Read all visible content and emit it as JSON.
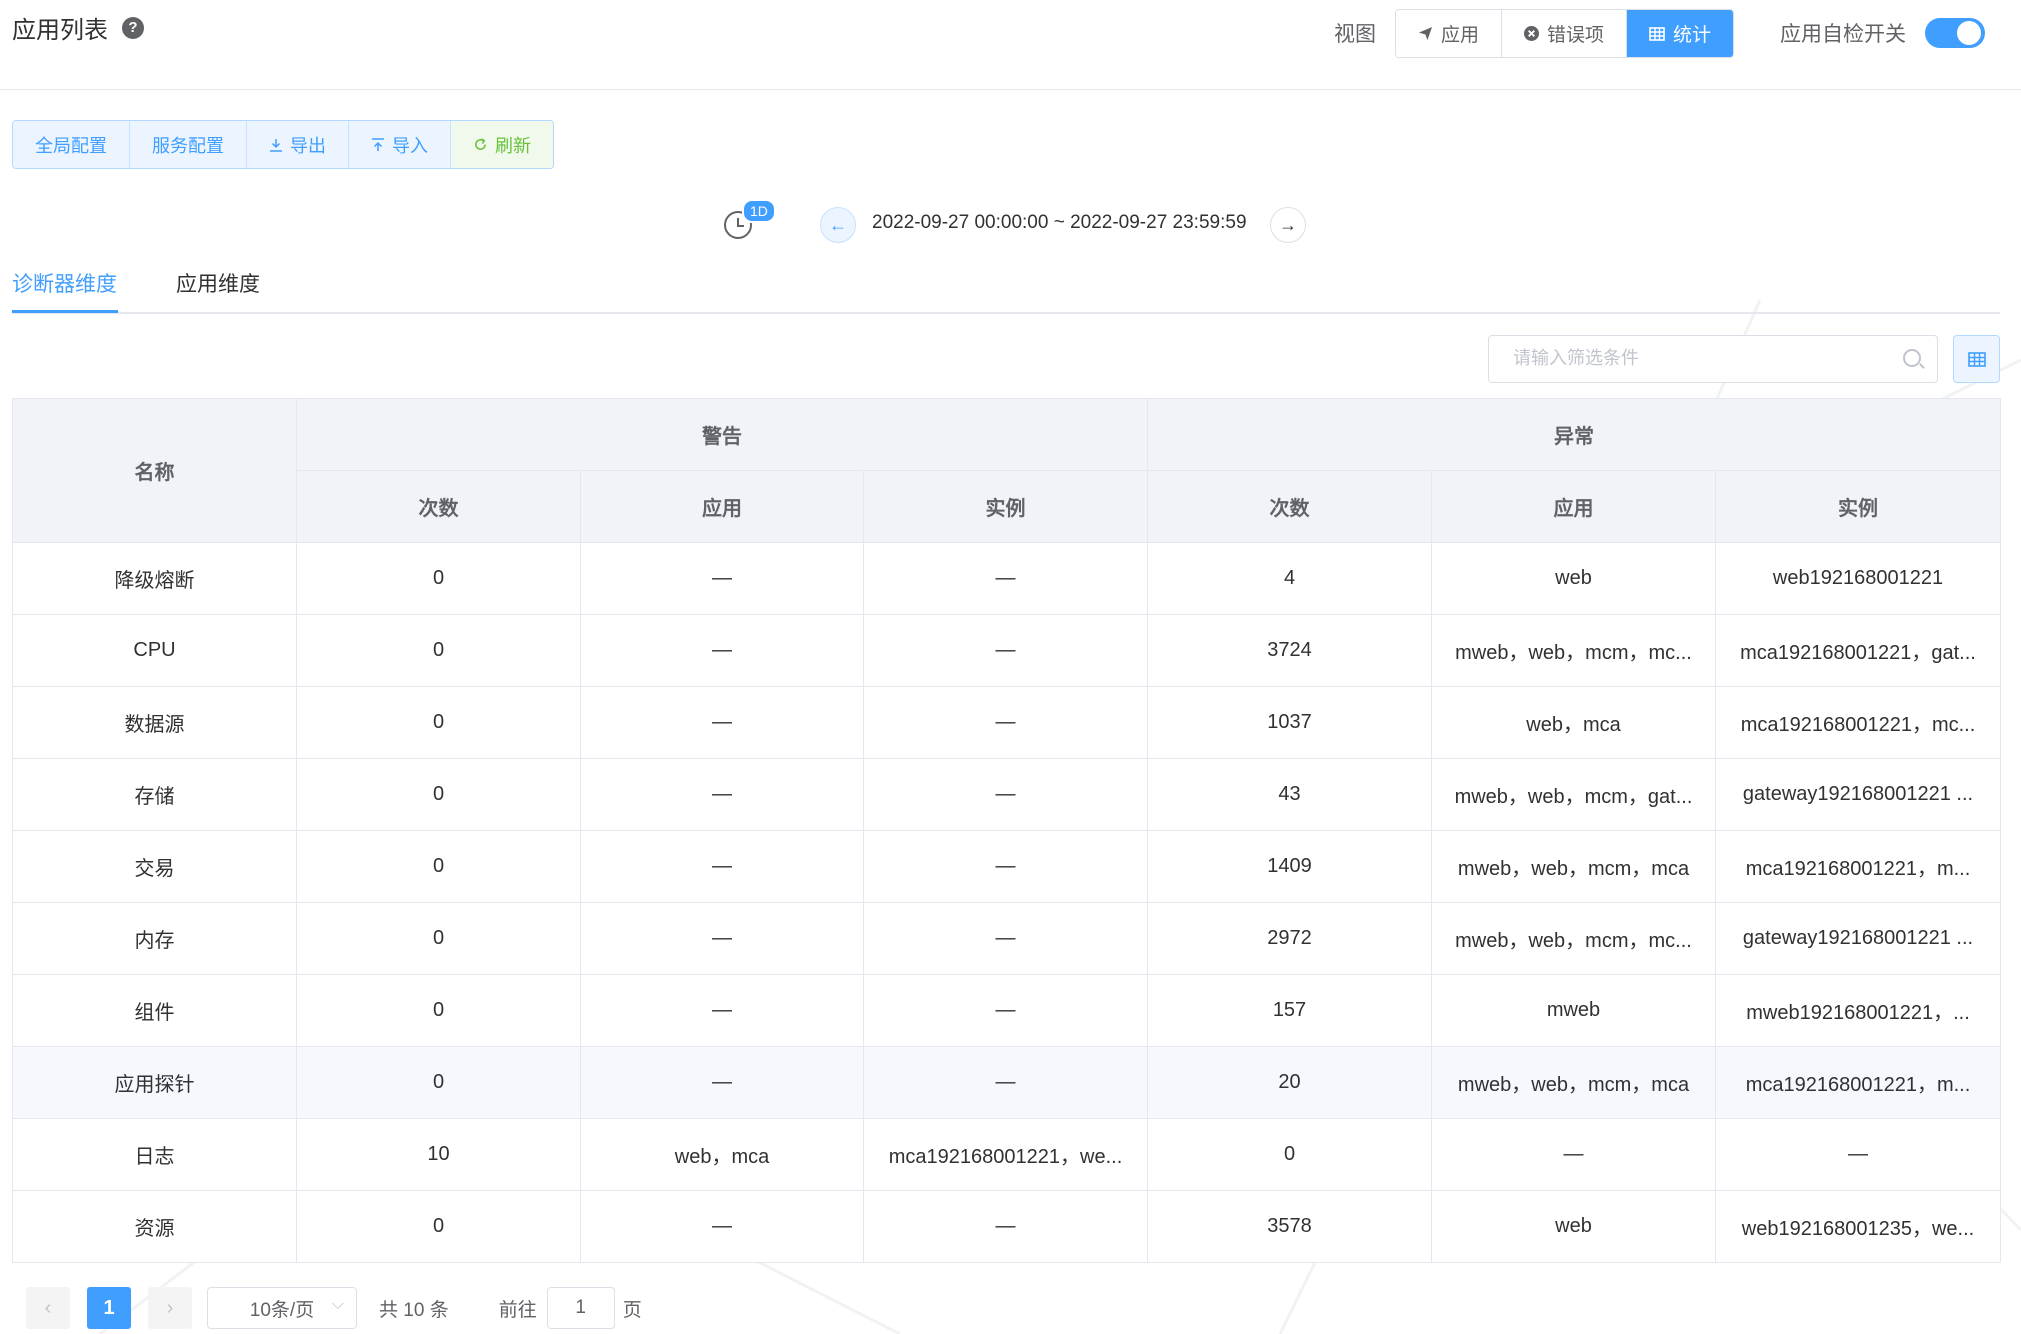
{
  "header": {
    "title": "应用列表",
    "help_icon": "question-circle-icon",
    "view_label": "视图",
    "view_buttons": [
      {
        "label": "应用",
        "icon": "send-icon"
      },
      {
        "label": "错误项",
        "icon": "close-circle-icon"
      },
      {
        "label": "统计",
        "icon": "grid-table-icon",
        "active": true
      }
    ],
    "self_check_label": "应用自检开关",
    "self_check_on": true
  },
  "toolbar": {
    "global_config": "全局配置",
    "service_config": "服务配置",
    "export": "导出",
    "import": "导入",
    "refresh": "刷新"
  },
  "time": {
    "badge": "1D",
    "range": "2022-09-27 00:00:00 ~ 2022-09-27 23:59:59"
  },
  "tabs": [
    "诊断器维度",
    "应用维度"
  ],
  "filter": {
    "placeholder": "请输入筛选条件"
  },
  "table": {
    "name_header": "名称",
    "warning_header": "警告",
    "error_header": "异常",
    "sub_headers": [
      "次数",
      "应用",
      "实例",
      "次数",
      "应用",
      "实例"
    ],
    "rows": [
      [
        "降级熔断",
        "0",
        "—",
        "—",
        "4",
        "web",
        "web192168001221"
      ],
      [
        "CPU",
        "0",
        "—",
        "—",
        "3724",
        "mweb，web，mcm，mc...",
        "mca192168001221，gat..."
      ],
      [
        "数据源",
        "0",
        "—",
        "—",
        "1037",
        "web，mca",
        "mca192168001221，mc..."
      ],
      [
        "存储",
        "0",
        "—",
        "—",
        "43",
        "mweb，web，mcm，gat...",
        "gateway192168001221 ..."
      ],
      [
        "交易",
        "0",
        "—",
        "—",
        "1409",
        "mweb，web，mcm，mca",
        "mca192168001221，m..."
      ],
      [
        "内存",
        "0",
        "—",
        "—",
        "2972",
        "mweb，web，mcm，mc...",
        "gateway192168001221 ..."
      ],
      [
        "组件",
        "0",
        "—",
        "—",
        "157",
        "mweb",
        "mweb192168001221，..."
      ],
      [
        "应用探针",
        "0",
        "—",
        "—",
        "20",
        "mweb，web，mcm，mca",
        "mca192168001221，m..."
      ],
      [
        "日志",
        "10",
        "web，mca",
        "mca192168001221，we...",
        "0",
        "—",
        "—"
      ],
      [
        "资源",
        "0",
        "—",
        "—",
        "3578",
        "web",
        "web192168001235，we..."
      ]
    ]
  },
  "pagination": {
    "current": "1",
    "page_size": "10条/页",
    "total": "共 10 条",
    "goto": "前往",
    "goto_value": "1",
    "page_suffix": "页"
  },
  "colors": {
    "primary": "#409eff",
    "success": "#67c23a"
  }
}
